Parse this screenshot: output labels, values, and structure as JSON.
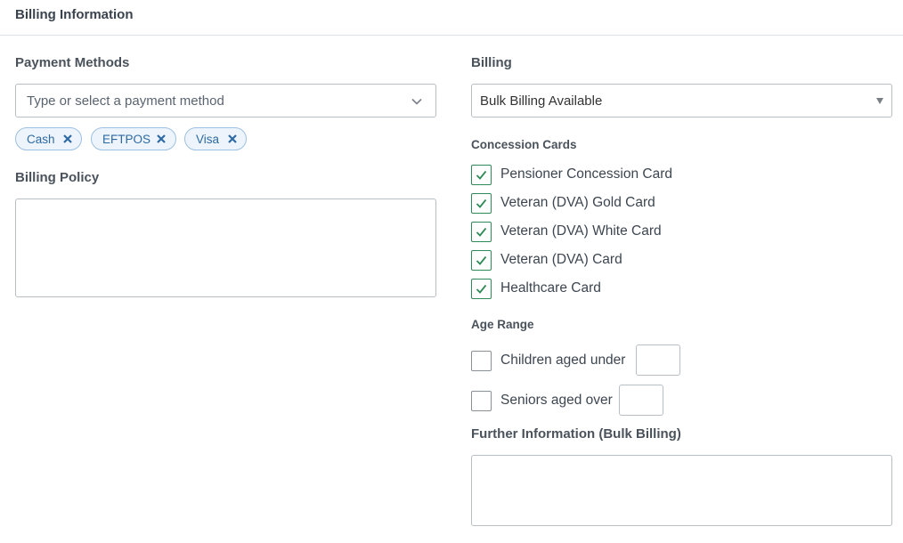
{
  "header": {
    "title": "Billing Information"
  },
  "payment_methods": {
    "label": "Payment Methods",
    "placeholder": "Type or select a payment method",
    "selected": [
      "Cash",
      "EFTPOS",
      "Visa"
    ]
  },
  "billing_policy": {
    "label": "Billing Policy",
    "value": ""
  },
  "billing": {
    "label": "Billing",
    "selected": "Bulk Billing Available"
  },
  "concession_cards": {
    "label": "Concession Cards",
    "items": [
      {
        "label": "Pensioner Concession Card",
        "checked": true
      },
      {
        "label": "Veteran (DVA) Gold Card",
        "checked": true
      },
      {
        "label": "Veteran (DVA) White Card",
        "checked": true
      },
      {
        "label": "Veteran (DVA) Card",
        "checked": true
      },
      {
        "label": "Healthcare Card",
        "checked": true
      }
    ]
  },
  "age_range": {
    "label": "Age Range",
    "children": {
      "label": "Children aged under",
      "checked": false,
      "value": ""
    },
    "seniors": {
      "label": "Seniors aged over",
      "checked": false,
      "value": ""
    }
  },
  "further_info": {
    "label": "Further Information (Bulk Billing)",
    "value": ""
  },
  "colors": {
    "accent": "#2d6aa3",
    "check": "#2e8b57",
    "border": "#b9bec4"
  }
}
